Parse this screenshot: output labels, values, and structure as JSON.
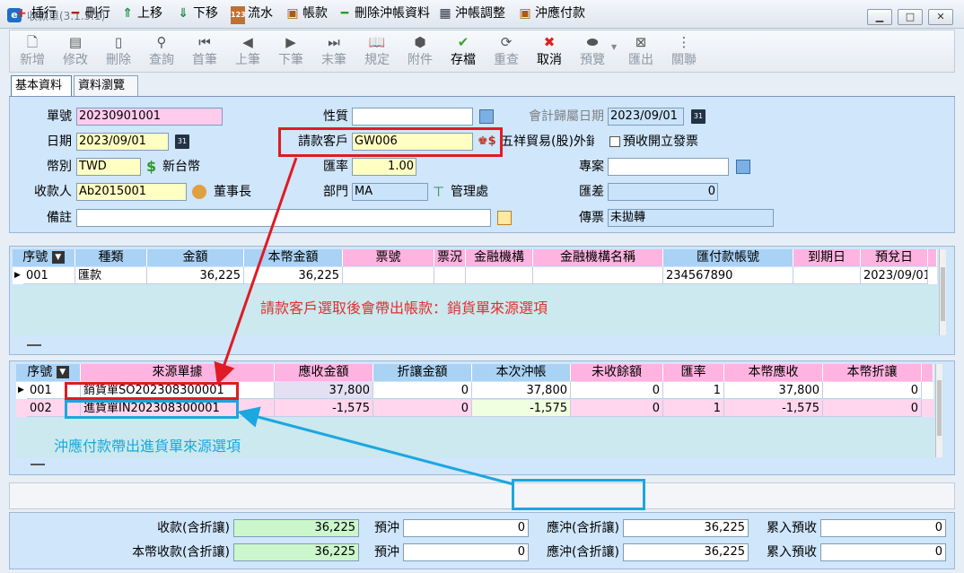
{
  "window": {
    "title": "收款單(3.1.5.1)",
    "app_icon": "app-logo-icon"
  },
  "toolbar": {
    "buttons": [
      {
        "label": "新增",
        "icon": "new-doc-icon",
        "enabled": false
      },
      {
        "label": "修改",
        "icon": "edit-icon",
        "enabled": false
      },
      {
        "label": "刪除",
        "icon": "trash-icon",
        "enabled": false
      },
      {
        "label": "查詢",
        "icon": "search-icon",
        "enabled": false
      },
      {
        "label": "首筆",
        "icon": "first-record-icon",
        "enabled": false
      },
      {
        "label": "上筆",
        "icon": "prev-record-icon",
        "enabled": false
      },
      {
        "label": "下筆",
        "icon": "next-record-icon",
        "enabled": false
      },
      {
        "label": "末筆",
        "icon": "last-record-icon",
        "enabled": false
      },
      {
        "label": "規定",
        "icon": "book-icon",
        "enabled": false
      },
      {
        "label": "附件",
        "icon": "attachment-icon",
        "enabled": false
      },
      {
        "label": "存檔",
        "icon": "save-check-icon",
        "enabled": true
      },
      {
        "label": "重查",
        "icon": "refresh-icon",
        "enabled": false
      },
      {
        "label": "取消",
        "icon": "cancel-icon",
        "enabled": true
      },
      {
        "label": "預覽",
        "icon": "print-preview-icon",
        "enabled": false
      },
      {
        "label": "匯出",
        "icon": "export-icon",
        "enabled": false
      },
      {
        "label": "關聯",
        "icon": "relation-icon",
        "enabled": false
      }
    ]
  },
  "tabs": [
    {
      "label": "基本資料"
    },
    {
      "label": "資料瀏覽"
    }
  ],
  "form": {
    "doc_no_label": "單號",
    "doc_no": "20230901001",
    "date_label": "日期",
    "date": "2023/09/01",
    "currency_label": "幣別",
    "currency": "TWD",
    "currency_name": "新台幣",
    "payee_label": "收款人",
    "payee": "Ab2015001",
    "payee_name": "董事長",
    "remark_label": "備註",
    "remark": "",
    "nature_label": "性質",
    "nature": "",
    "customer_label": "請款客戶",
    "customer": "GW006",
    "customer_name": "五祥貿易(股)外銷",
    "rate_label": "匯率",
    "rate": "1.00",
    "dept_label": "部門",
    "dept": "MA",
    "dept_name": "管理處",
    "acct_date_label": "會計歸屬日期",
    "acct_date": "2023/09/01",
    "pre_invoice_label": "預收開立發票",
    "project_label": "專案",
    "project": "",
    "fx_diff_label": "匯差",
    "fx_diff": "0",
    "voucher_label": "傳票",
    "voucher": "未拋轉"
  },
  "grid1": {
    "headers": [
      "序號",
      "種類",
      "金額",
      "本幣金額",
      "票號",
      "票況",
      "金融機構",
      "金融機構名稱",
      "匯付款帳號",
      "到期日",
      "預兌日"
    ],
    "rows": [
      [
        "001",
        "匯款",
        "36,225",
        "36,225",
        "",
        "",
        "",
        "",
        "234567890",
        "",
        "2023/09/01"
      ]
    ]
  },
  "annotation1": "請款客戶選取後會帶出帳款：銷貨單來源選項",
  "grid2": {
    "headers": [
      "序號",
      "來源單據",
      "應收金額",
      "折讓金額",
      "本次沖帳",
      "未收餘額",
      "匯率",
      "本幣應收",
      "本幣折讓"
    ],
    "rows": [
      [
        "001",
        "銷貨單SO202308300001",
        "37,800",
        "0",
        "37,800",
        "0",
        "1",
        "37,800",
        "0"
      ],
      [
        "002",
        "進貨單IN202308300001",
        "-1,575",
        "0",
        "-1,575",
        "0",
        "1",
        "-1,575",
        "0"
      ]
    ]
  },
  "annotation2": "沖應付款帶出進貨單來源選項",
  "bottom_tools": {
    "insert": "插行",
    "delete": "刪行",
    "up": "上移",
    "down": "下移",
    "serial": "流水",
    "account": "帳款",
    "delete_offset": "刪除沖帳資料",
    "offset_adjust": "沖帳調整",
    "offset_payable": "沖應付款"
  },
  "totals": {
    "receipt_label": "收款(含折讓)",
    "receipt": "36,225",
    "prepay_label": "預沖",
    "prepay": "0",
    "offset_label": "應沖(含折讓)",
    "offset": "36,225",
    "accum_label": "累入預收",
    "accum": "0",
    "local_receipt_label": "本幣收款(含折讓)",
    "local_receipt": "36,225",
    "local_prepay": "0",
    "local_offset": "36,225",
    "local_accum": "0"
  },
  "colors": {
    "highlight_red": "#e01b24",
    "highlight_cyan": "#1ba7e0",
    "annotation_red": "#e03030",
    "annotation_cyan": "#1ba7e0"
  }
}
